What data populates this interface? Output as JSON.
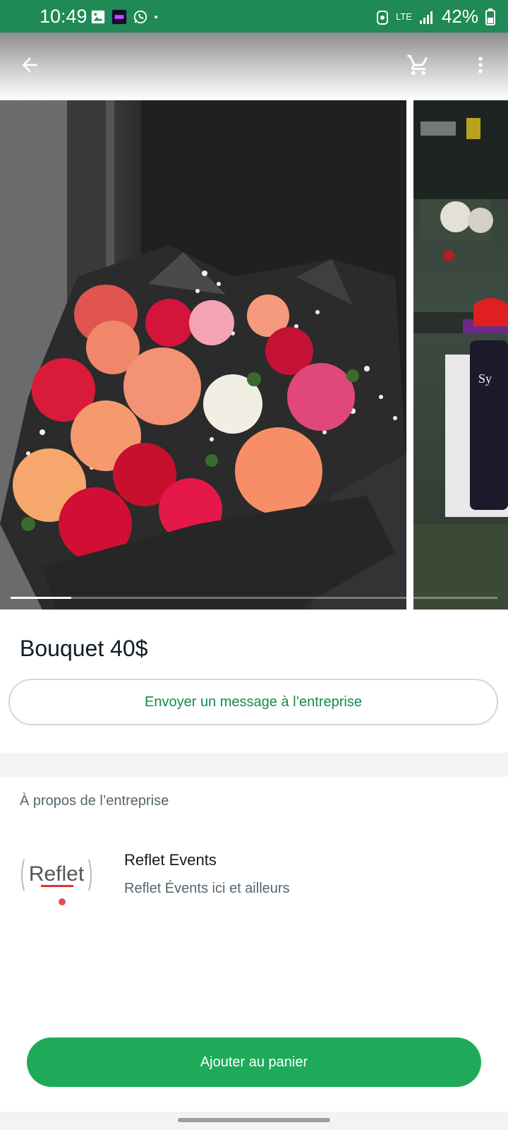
{
  "status_bar": {
    "time": "10:49",
    "network": "LTE",
    "battery": "42%",
    "bg_color": "#1f8a55"
  },
  "app_bar": {
    "back_icon": "arrow-back-icon",
    "cart_icon": "cart-icon",
    "menu_icon": "more-vert-icon"
  },
  "gallery": {
    "current_index": 1,
    "total_images": 8
  },
  "product": {
    "title": "Bouquet 40$",
    "message_button": "Envoyer un message à l’entreprise"
  },
  "about": {
    "section_label": "À propos de l’entreprise",
    "business_name": "Reflet Events",
    "business_description": "Reflet Évents ici et ailleurs",
    "logo_text": "Reflet"
  },
  "actions": {
    "add_to_cart": "Ajouter au panier"
  },
  "colors": {
    "accent": "#1faa59",
    "accent_text": "#128c4a"
  }
}
